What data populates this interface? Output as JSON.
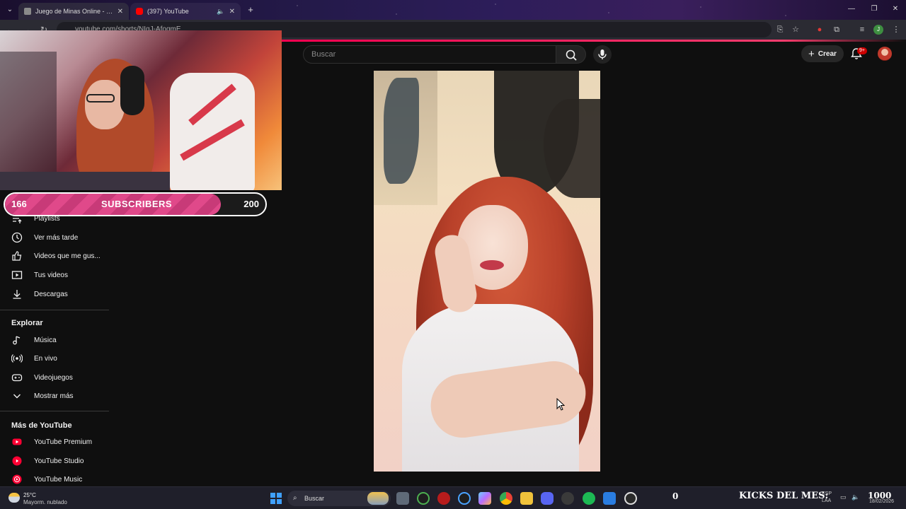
{
  "browser": {
    "tabs": [
      {
        "title": "Juego de Minas Online - Disfruta",
        "favicon_color": "#8a8a8a"
      },
      {
        "title": "(397) YouTube",
        "favicon_color": "#ff0000"
      }
    ],
    "url": "youtube.com/shorts/NIqJ-AfoqmE"
  },
  "header": {
    "search_placeholder": "Buscar",
    "create_label": "Crear",
    "notification_count": "9+"
  },
  "sidebar": {
    "you_items": [
      {
        "label": "Playlists",
        "icon": "playlist-icon"
      },
      {
        "label": "Ver más tarde",
        "icon": "clock-icon"
      },
      {
        "label": "Videos que me gus...",
        "icon": "thumbs-up-icon"
      },
      {
        "label": "Tus videos",
        "icon": "play-square-icon"
      },
      {
        "label": "Descargas",
        "icon": "download-icon"
      }
    ],
    "explore_title": "Explorar",
    "explore_items": [
      {
        "label": "Música",
        "icon": "music-note-icon"
      },
      {
        "label": "En vivo",
        "icon": "live-icon"
      },
      {
        "label": "Videojuegos",
        "icon": "gamepad-icon"
      },
      {
        "label": "Mostrar más",
        "icon": "chevron-down-icon"
      }
    ],
    "more_title": "Más de YouTube",
    "more_items": [
      {
        "label": "YouTube Premium",
        "icon": "youtube-premium-icon"
      },
      {
        "label": "YouTube Studio",
        "icon": "youtube-studio-icon"
      },
      {
        "label": "YouTube Music",
        "icon": "youtube-music-icon"
      }
    ]
  },
  "overlay": {
    "subs_current": "166",
    "subs_label": "SUBSCRIBERS",
    "subs_goal": "200",
    "subs_progress": 0.83
  },
  "taskbar": {
    "weather_temp": "25°C",
    "weather_desc": "Mayorm. nublado",
    "search_label": "Buscar",
    "kicks_count": "0",
    "kicks_label": "KICKS DEL MES:",
    "kicks_goal": "1000",
    "lang_top": "ESP",
    "lang_bottom": "LAA",
    "date": "18/02/2026"
  },
  "colors": {
    "accent": "#ff0050",
    "subbar_pink": "#e0498a",
    "page_bg": "#0f0f0f"
  }
}
